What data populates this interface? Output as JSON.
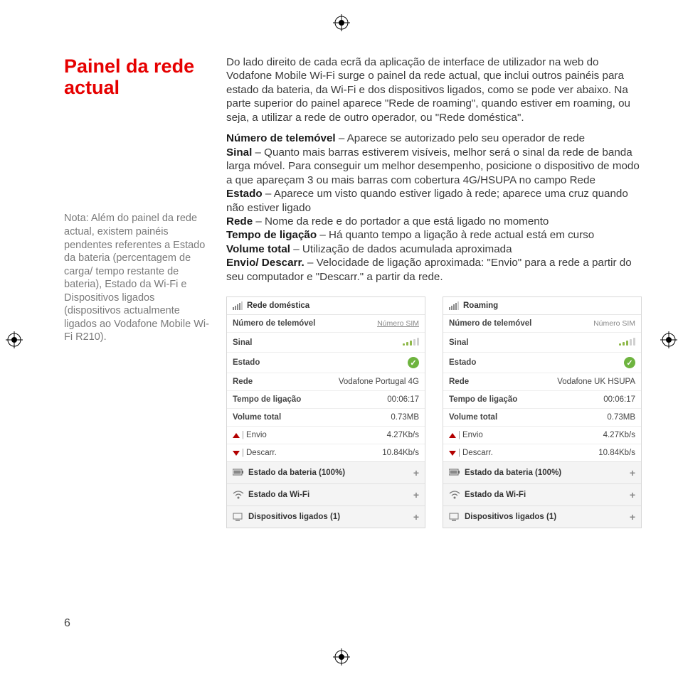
{
  "title": "Painel da rede actual",
  "note_text": "Nota: Além do painel da rede actual, existem painéis pendentes referentes a Estado da bateria (percentagem de carga/ tempo restante de bateria), Estado da Wi-Fi e Dispositivos ligados (dispositivos actualmente ligados ao Vodafone Mobile Wi-Fi R210).",
  "intro": "Do lado direito de cada ecrã da aplicação de interface de utilizador na web do Vodafone Mobile Wi-Fi surge o painel da rede actual, que inclui outros painéis para estado da bateria, da Wi-Fi e dos dispositivos ligados, como se pode ver abaixo. Na parte superior do painel aparece \"Rede de roaming\", quando estiver em roaming, ou seja, a utilizar a rede de outro operador, ou \"Rede doméstica\".",
  "defs": {
    "numero_b": "Número de telemóvel",
    "numero_t": " – Aparece se autorizado pelo seu operador de rede",
    "sinal_b": "Sinal",
    "sinal_t": " – Quanto mais barras estiverem visíveis, melhor será o sinal da rede de banda larga móvel. Para conseguir um melhor desempenho, posicione o dispositivo de modo a que apareçam 3 ou mais barras com cobertura 4G/HSUPA no campo Rede",
    "estado_b": "Estado",
    "estado_t": " – Aparece um visto quando estiver ligado à rede; aparece uma cruz quando não estiver ligado",
    "rede_b": "Rede",
    "rede_t": " – Nome da rede e do portador a que está ligado no momento",
    "tempo_b": "Tempo de ligação",
    "tempo_t": " – Há quanto tempo a ligação à rede actual está em curso",
    "volume_b": "Volume total",
    "volume_t": " – Utilização de dados acumulada aproximada",
    "envio_b": "Envio/ Descarr.",
    "envio_t": " – Velocidade de ligação aproximada: \"Envio\" para a rede a partir do seu computador e \"Descarr.\" a partir da rede."
  },
  "panel_labels": {
    "numero": "Número de telemóvel",
    "sinal": "Sinal",
    "estado": "Estado",
    "rede": "Rede",
    "tempo": "Tempo de ligação",
    "volume": "Volume total",
    "envio": "Envio",
    "descarr": "Descarr.",
    "sim_link": "Número SIM",
    "exp_bateria": "Estado da bateria (100%)",
    "exp_wifi": "Estado da Wi-Fi",
    "exp_disp": "Dispositivos ligados (1)",
    "plus": "+"
  },
  "panel1": {
    "header": "Rede doméstica",
    "rede": "Vodafone Portugal 4G",
    "tempo": "00:06:17",
    "volume": "0.73MB",
    "envio": "4.27Kb/s",
    "descarr": "10.84Kb/s"
  },
  "panel2": {
    "header": "Roaming",
    "rede": "Vodafone UK HSUPA",
    "tempo": "00:06:17",
    "volume": "0.73MB",
    "envio": "4.27Kb/s",
    "descarr": "10.84Kb/s"
  },
  "page_number": "6"
}
